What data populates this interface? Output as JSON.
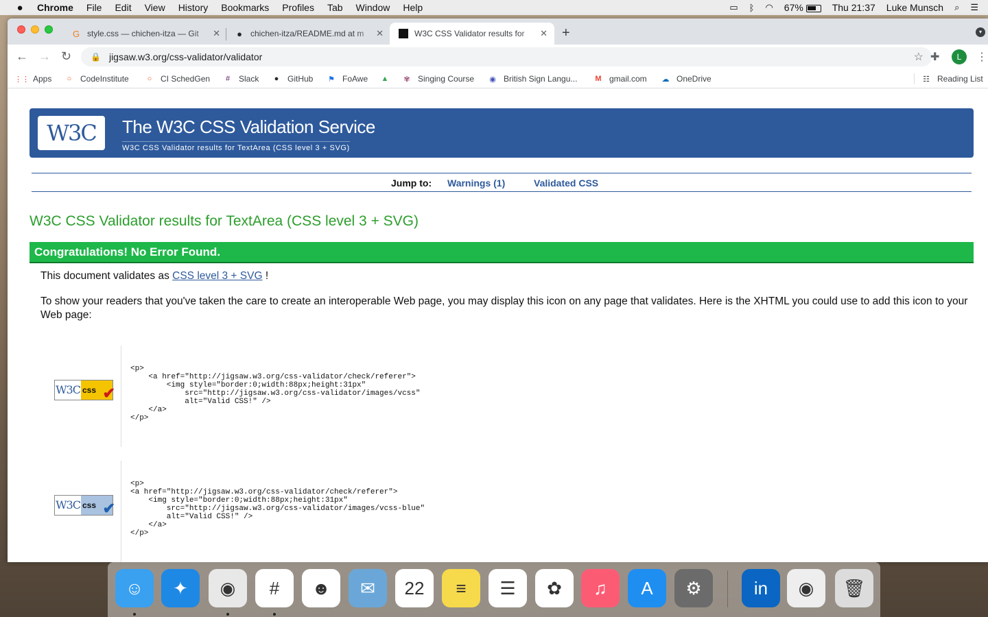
{
  "menubar": {
    "app_name": "Chrome",
    "menus": [
      "File",
      "Edit",
      "View",
      "History",
      "Bookmarks",
      "Profiles",
      "Tab",
      "Window",
      "Help"
    ],
    "battery": "67%",
    "clock": "Thu 21:37",
    "user": "Luke Munsch"
  },
  "tabs": [
    {
      "title": "style.css — chichen-itza — Git",
      "icon": "gitpod-icon",
      "active": false
    },
    {
      "title": "chichen-itza/README.md at m",
      "icon": "github-icon",
      "active": false
    },
    {
      "title": "W3C CSS Validator results for",
      "icon": "w3c-icon",
      "active": true
    }
  ],
  "address_bar": {
    "url": "jigsaw.w3.org/css-validator/validator"
  },
  "profile_initial": "L",
  "bookmarks": [
    {
      "label": "Apps",
      "icon": "apps-grid-icon",
      "color": "#e8453c"
    },
    {
      "label": "CodeInstitute",
      "icon": "ring-icon",
      "color": "#e8571c"
    },
    {
      "label": "CI SchedGen",
      "icon": "ring-icon",
      "color": "#e8571c"
    },
    {
      "label": "Slack",
      "icon": "slack-icon",
      "color": "#611f69"
    },
    {
      "label": "GitHub",
      "icon": "github-icon",
      "color": "#24292e"
    },
    {
      "label": "FoAwe",
      "icon": "flag-icon",
      "color": "#1a73e8"
    },
    {
      "label": "",
      "icon": "google-drive-icon",
      "color": "#34a853"
    },
    {
      "label": "Singing Course",
      "icon": "singing-icon",
      "color": "#a0527c"
    },
    {
      "label": "British Sign Langu...",
      "icon": "sign-language-icon",
      "color": "#3f51b5"
    },
    {
      "label": "gmail.com",
      "icon": "gmail-icon",
      "color": "#ea4335"
    },
    {
      "label": "OneDrive",
      "icon": "cloud-icon",
      "color": "#0f6cbd"
    }
  ],
  "reading_list": "Reading List",
  "page": {
    "banner_title": "The W3C CSS Validation Service",
    "banner_subtitle": "W3C CSS Validator results for TextArea (CSS level 3 + SVG)",
    "logo_text": "W3C",
    "jump_label": "Jump to:",
    "jump_links": [
      "Warnings (1)",
      "Validated CSS"
    ],
    "results_title": "W3C CSS Validator results for TextArea (CSS level 3 + SVG)",
    "congrats": "Congratulations! No Error Found.",
    "validates_prefix": "This document validates as",
    "validates_link": "CSS level 3 + SVG",
    "validates_suffix": "!",
    "explain": "To show your readers that you've taken the care to create an interoperable Web page, you may display this icon on any page that validates. Here is the XHTML you could use to add this icon to your Web page:",
    "badges": [
      {
        "w3c": "W3C",
        "css": "css",
        "bg": "#f5c400",
        "check_color": "#cc1a1a",
        "code": "<p>\n    <a href=\"http://jigsaw.w3.org/css-validator/check/referer\">\n        <img style=\"border:0;width:88px;height:31px\"\n            src=\"http://jigsaw.w3.org/css-validator/images/vcss\"\n            alt=\"Valid CSS!\" />\n    </a>\n</p>"
      },
      {
        "w3c": "W3C",
        "css": "css",
        "bg": "#a8c2e0",
        "check_color": "#1f5fae",
        "code": "<p>\n<a href=\"http://jigsaw.w3.org/css-validator/check/referer\">\n    <img style=\"border:0;width:88px;height:31px\"\n        src=\"http://jigsaw.w3.org/css-validator/images/vcss-blue\"\n        alt=\"Valid CSS!\" />\n    </a>\n</p>"
      }
    ]
  },
  "dock": [
    {
      "name": "finder-icon",
      "color": "#3aa0f0",
      "glyph": "☺",
      "running": true
    },
    {
      "name": "safari-icon",
      "color": "#1e88e5",
      "glyph": "✦",
      "running": false
    },
    {
      "name": "chrome-icon",
      "color": "#e8e8e8",
      "glyph": "◉",
      "running": true
    },
    {
      "name": "slack-icon",
      "color": "#ffffff",
      "glyph": "#",
      "running": true
    },
    {
      "name": "smiley-app-icon",
      "color": "#ffffff",
      "glyph": "☻",
      "running": false
    },
    {
      "name": "preview-icon",
      "color": "#6aa7d8",
      "glyph": "✉",
      "running": false
    },
    {
      "name": "calendar-icon",
      "color": "#ffffff",
      "glyph": "22",
      "running": false
    },
    {
      "name": "notes-icon",
      "color": "#f7d94c",
      "glyph": "≡",
      "running": false
    },
    {
      "name": "reminders-icon",
      "color": "#ffffff",
      "glyph": "☰",
      "running": false
    },
    {
      "name": "photos-icon",
      "color": "#ffffff",
      "glyph": "✿",
      "running": false
    },
    {
      "name": "music-icon",
      "color": "#fb5c74",
      "glyph": "♫",
      "running": false
    },
    {
      "name": "app-store-icon",
      "color": "#1f8ef1",
      "glyph": "A",
      "running": false
    },
    {
      "name": "system-preferences-icon",
      "color": "#6b6b6b",
      "glyph": "⚙",
      "running": false
    },
    {
      "name": "linkedin-icon",
      "color": "#0a66c2",
      "glyph": "in",
      "running": false
    },
    {
      "name": "chrome-window-icon",
      "color": "#eeeeee",
      "glyph": "◉",
      "running": false
    },
    {
      "name": "trash-icon",
      "color": "#dcdcdc",
      "glyph": "🗑",
      "running": false
    }
  ]
}
